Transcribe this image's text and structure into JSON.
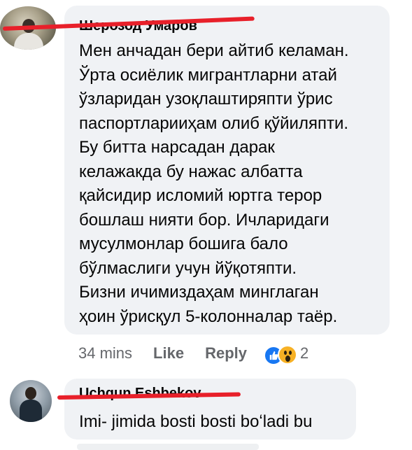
{
  "comment1": {
    "author": "Шерозод Умаров",
    "lines": [
      "Мен анчадан бери айтиб келаман.",
      "Ўрта осиёлик мигрантларни атай",
      "ўзларидан узоқлаштиряпти ўрис",
      "паспортларииҳам олиб қўйиляпти.",
      "Бу битта нарсадан дарак",
      "келажакда бу нажас албатта",
      "қайсидир исломий юртга терор",
      "бошлаш нияти бор. Ичларидаги",
      "мусулмонлар бошига бало",
      "бўлмаслиги учун йўқотяпти.",
      "Бизни ичимиздаҳам минглаган",
      "ҳоин ўрисқул 5-колонналар таёр."
    ],
    "time": "34 mins",
    "like_label": "Like",
    "reply_label": "Reply",
    "reactions": {
      "icons": [
        "like-icon",
        "wow-icon"
      ],
      "count": "2"
    }
  },
  "comment2": {
    "author": "Uchqun Eshbekov",
    "text": "Imi- jimida bosti bosti boʻladi bu"
  },
  "colors": {
    "bubble": "#f0f2f5",
    "redact": "#e8202a",
    "like_blue": "#1877f2",
    "wow_yellow": "#f7b125",
    "meta_gray": "#65676b"
  }
}
